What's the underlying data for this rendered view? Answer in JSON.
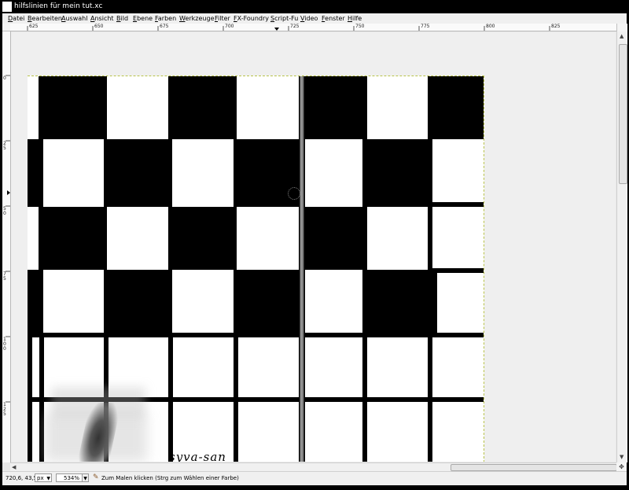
{
  "window": {
    "title": "hilfslinien für mein tut.xc",
    "colors": {
      "title_bg": "#000000",
      "title_text": "#ffffff",
      "menu_bg": "#f0f0f0"
    }
  },
  "menu": [
    {
      "label": "Datei"
    },
    {
      "label": "Bearbeiten"
    },
    {
      "label": "Auswahl"
    },
    {
      "label": "Ansicht"
    },
    {
      "label": "Bild"
    },
    {
      "label": "Ebene"
    },
    {
      "label": "Farben"
    },
    {
      "label": "Werkzeuge"
    },
    {
      "label": "Filter"
    },
    {
      "label": "FX-Foundry"
    },
    {
      "label": "Script-Fu"
    },
    {
      "label": "Video"
    },
    {
      "label": "Fenster"
    },
    {
      "label": "Hilfe"
    }
  ],
  "ruler": {
    "horizontal_labels": [
      "625",
      "650",
      "675",
      "700",
      "725",
      "750",
      "775",
      "800",
      "825"
    ],
    "vertical_labels": [
      "0",
      "25",
      "50",
      "75",
      "100",
      "125"
    ]
  },
  "canvas": {
    "signature": "syva-san",
    "colors": {
      "ink": "#000000",
      "paper": "#ffffff",
      "guide": "#888888",
      "boundary": "#b8c24a"
    }
  },
  "statusbar": {
    "coords": "720,6, 43,5",
    "unit": "px",
    "zoom": "534%",
    "hint": "Zum Malen klicken (Strg zum Wählen einer Farbe)",
    "icons": {
      "unit_dropdown": "chevron-down-icon",
      "hint": "brush-icon"
    }
  }
}
